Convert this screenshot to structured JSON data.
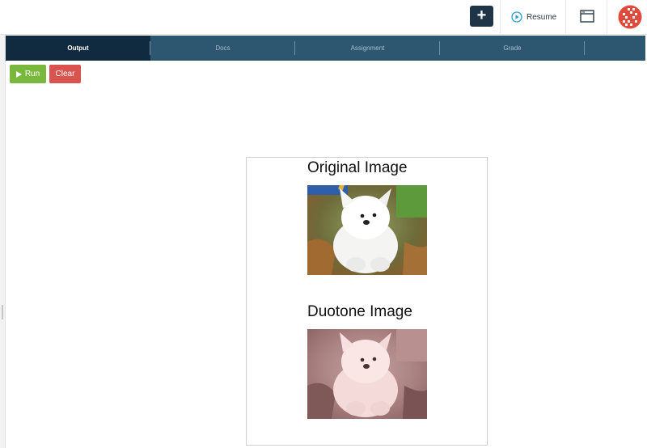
{
  "topbar": {
    "add_label": "+",
    "resume_label": "Resume",
    "icons": [
      "plus-icon",
      "play-circle-icon",
      "window-icon",
      "avatar"
    ],
    "colors": {
      "add_button": "#1f3447",
      "resume_icon": "#2a9fd6",
      "avatar": "#e04a3a"
    }
  },
  "tabs": [
    {
      "label": "Output",
      "active": true
    },
    {
      "label": "Docs",
      "active": false
    },
    {
      "label": "Assignment",
      "active": false
    },
    {
      "label": "Grade",
      "active": false
    }
  ],
  "toolbar": {
    "run_label": "Run",
    "clear_label": "Clear",
    "colors": {
      "run": "#79b83c",
      "clear": "#d9534f"
    }
  },
  "output": {
    "original_heading": "Original Image",
    "duotone_heading": "Duotone Image"
  }
}
